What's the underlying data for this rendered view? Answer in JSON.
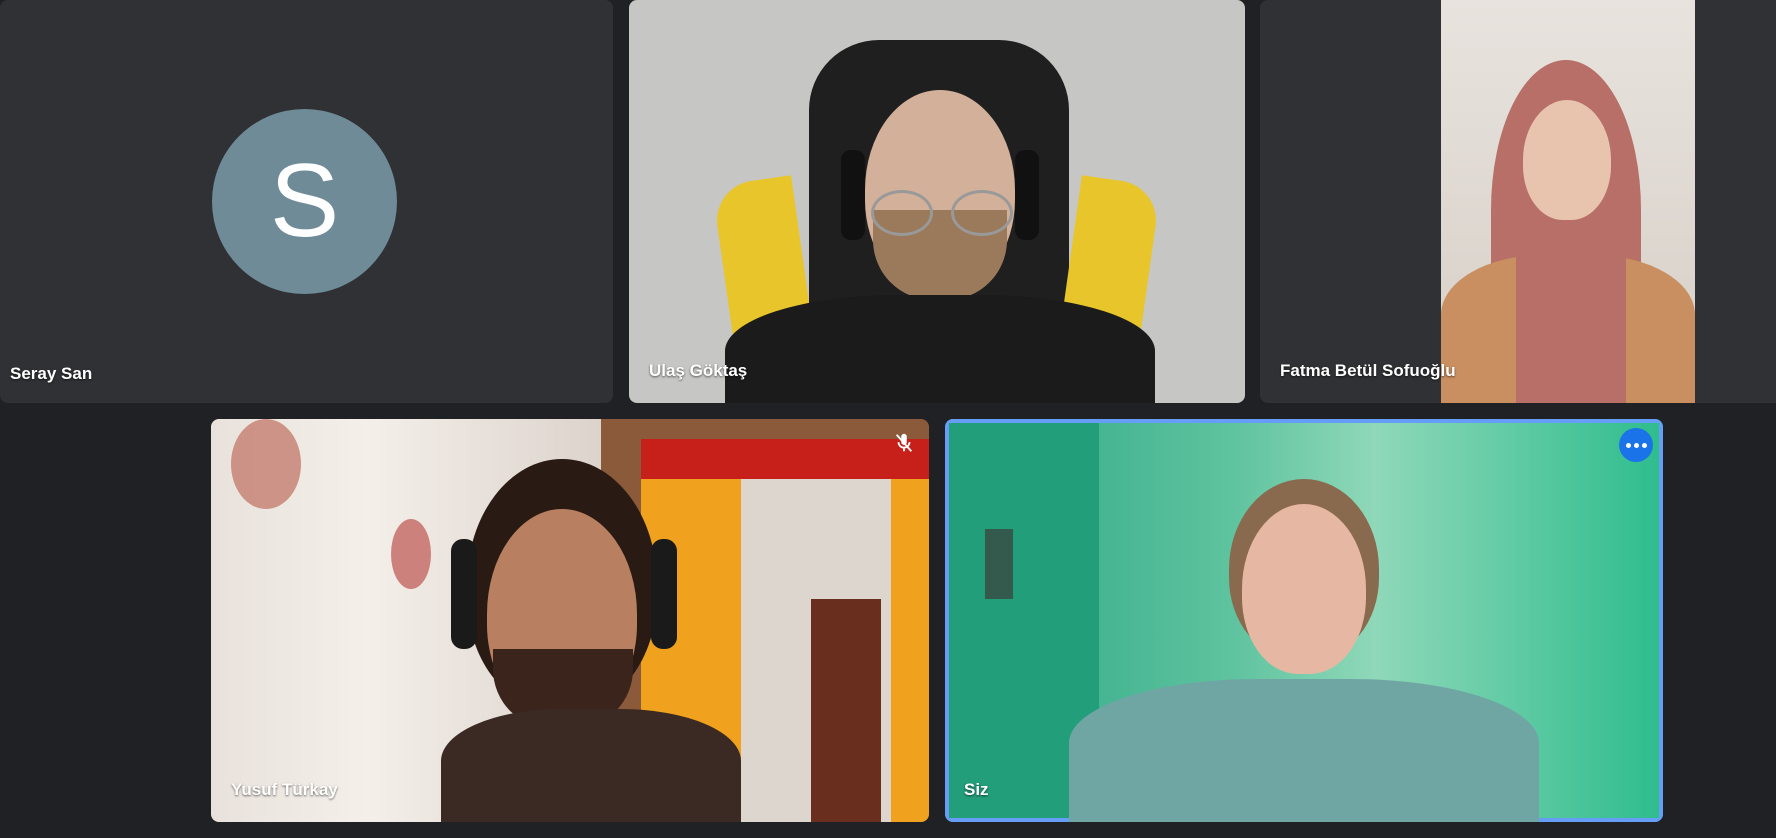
{
  "participants": [
    {
      "name": "Seray San",
      "avatar_letter": "S",
      "video": false
    },
    {
      "name": "Ulaş Göktaş",
      "video": true
    },
    {
      "name": "Fatma Betül Sofuoğlu",
      "video": true
    },
    {
      "name": "Yusuf Türkay",
      "video": true,
      "muted": true
    },
    {
      "name": "Siz",
      "video": true,
      "self": true,
      "active_speaker": true
    }
  ],
  "icons": {
    "mute": "mic-off-icon",
    "more": "more-options-icon"
  },
  "colors": {
    "background": "#202124",
    "tile_background": "#303134",
    "avatar_color": "#6f8b98",
    "active_border": "#669df6",
    "more_button": "#1a73e8"
  }
}
